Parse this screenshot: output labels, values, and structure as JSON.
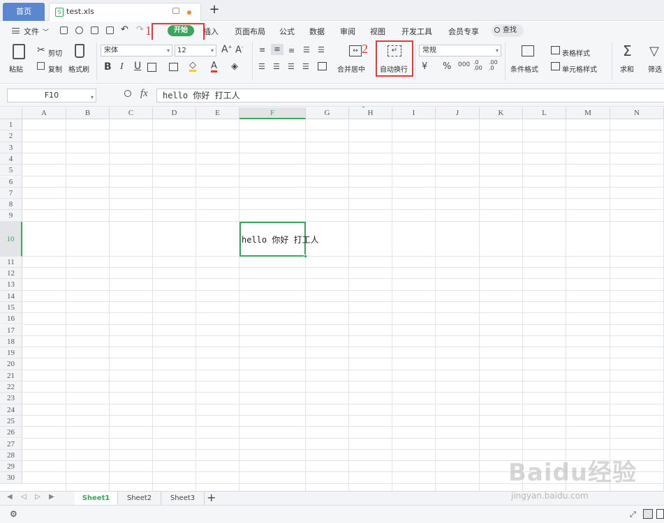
{
  "titlebar": {
    "home_tab": "首页",
    "file_tab": "test.xls",
    "new_tab_symbol": "+"
  },
  "menu": {
    "file_label": "文件",
    "items": [
      "开始",
      "插入",
      "页面布局",
      "公式",
      "数据",
      "审阅",
      "视图",
      "开发工具",
      "会员专享"
    ],
    "search_label": "查找"
  },
  "ribbon": {
    "paste": "粘贴",
    "cut": "剪切",
    "copy": "复制",
    "format_painter": "格式刷",
    "font_name": "宋体",
    "font_size": "12",
    "merge_center": "合并居中",
    "wrap_text": "自动换行",
    "number_format": "常规",
    "conditional_format": "条件格式",
    "table_style": "表格样式",
    "cell_style": "单元格样式",
    "sum": "求和",
    "filter": "筛选"
  },
  "formula_bar": {
    "cell_ref": "F10",
    "fx": "fx",
    "value": "hello 你好 打工人"
  },
  "annotations": {
    "label_1": "1",
    "label_2": "2",
    "box_color": "#e03a3a"
  },
  "grid": {
    "columns": [
      "A",
      "B",
      "C",
      "D",
      "E",
      "F",
      "G",
      "H",
      "I",
      "J",
      "K",
      "L",
      "M",
      "N"
    ],
    "rows": [
      "1",
      "2",
      "3",
      "4",
      "5",
      "6",
      "7",
      "8",
      "9",
      "10",
      "11",
      "12",
      "13",
      "14",
      "15",
      "16",
      "17",
      "18",
      "19",
      "20",
      "21",
      "22",
      "23",
      "24",
      "25",
      "26",
      "27",
      "28",
      "29",
      "30"
    ],
    "active_column": "F",
    "active_row": "10",
    "active_cell_text": "hello 你好 打工人"
  },
  "sheets": [
    "Sheet1",
    "Sheet2",
    "Sheet3"
  ],
  "watermark": {
    "main": "Baidu经验",
    "sub": "jingyan.baidu.com"
  },
  "colors": {
    "accent": "#3aa55d",
    "home_tab": "#5b86d0",
    "annotation": "#e03a3a"
  }
}
